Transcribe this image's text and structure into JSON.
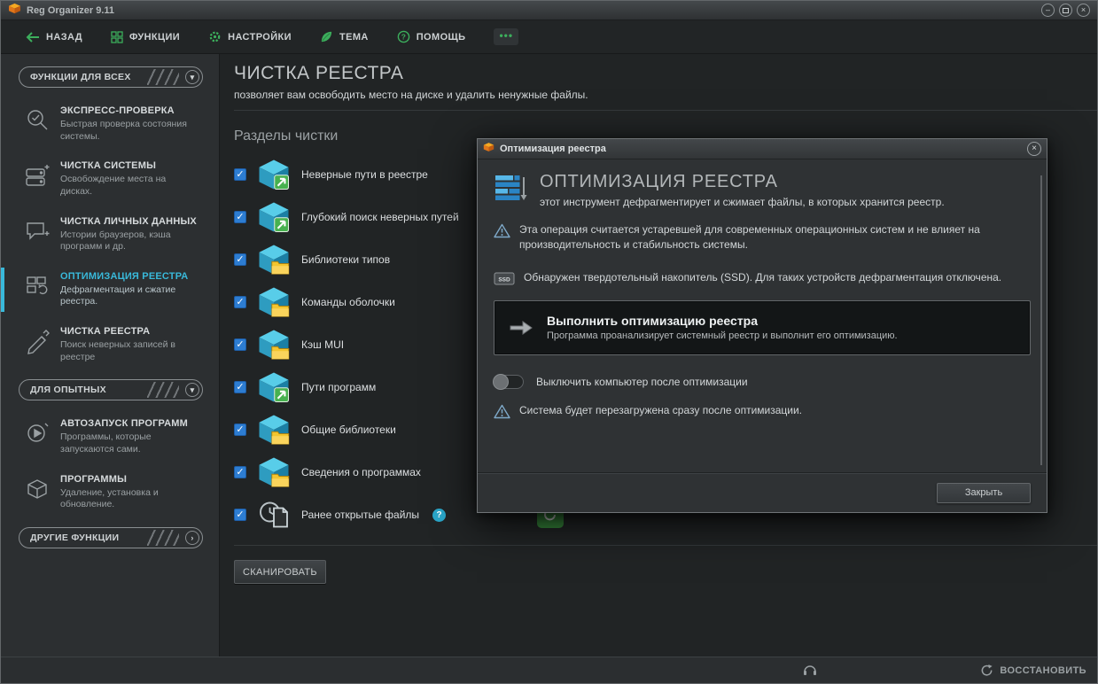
{
  "glyphs": {
    "close": "×",
    "minimize": "–",
    "chevron_down": "▾",
    "chevron_right": "›",
    "more": "•••",
    "check": "✓",
    "help": "?"
  },
  "window": {
    "title": "Reg Organizer 9.11"
  },
  "toolbar": {
    "back": "НАЗАД",
    "functions": "ФУНКЦИИ",
    "settings": "НАСТРОЙКИ",
    "theme": "ТЕМА",
    "help": "ПОМОЩЬ"
  },
  "sidebar": {
    "group1_header": "ФУНКЦИИ ДЛЯ ВСЕХ",
    "group2_header": "ДЛЯ ОПЫТНЫХ",
    "group3_header": "ДРУГИЕ ФУНКЦИИ",
    "items": [
      {
        "title": "ЭКСПРЕСС-ПРОВЕРКА",
        "desc": "Быстрая проверка состояния системы.",
        "icon": "magnifier-check",
        "active": false
      },
      {
        "title": "ЧИСТКА СИСТЕМЫ",
        "desc": "Освобождение места на дисках.",
        "icon": "disk-clean",
        "active": false
      },
      {
        "title": "ЧИСТКА ЛИЧНЫХ ДАННЫХ",
        "desc": "Истории браузеров, кэша программ и др.",
        "icon": "chat-bubble-clean",
        "active": false
      },
      {
        "title": "ОПТИМИЗАЦИЯ РЕЕСТРА",
        "desc": "Дефрагментация и сжатие реестра.",
        "icon": "defrag-blocks",
        "active": true
      },
      {
        "title": "ЧИСТКА РЕЕСТРА",
        "desc": "Поиск неверных записей в реестре",
        "icon": "eraser-registry",
        "active": false
      },
      {
        "title": "АВТОЗАПУСК ПРОГРАММ",
        "desc": "Программы, которые запускаются сами.",
        "icon": "autostart-play",
        "active": false
      },
      {
        "title": "ПРОГРАММЫ",
        "desc": "Удаление, установка и обновление.",
        "icon": "package-box",
        "active": false
      }
    ]
  },
  "main": {
    "title": "ЧИСТКА РЕЕСТРА",
    "subtitle": "позволяет вам освободить место на диске и удалить ненужные файлы.",
    "section_title": "Разделы чистки",
    "checklist": [
      {
        "label": "Неверные пути в реестре",
        "checked": true,
        "icon": "cube-arrow"
      },
      {
        "label": "Глубокий поиск неверных путей",
        "checked": true,
        "icon": "cube-arrow"
      },
      {
        "label": "Библиотеки типов",
        "checked": true,
        "icon": "cube-folder"
      },
      {
        "label": "Команды оболочки",
        "checked": true,
        "icon": "cube-folder"
      },
      {
        "label": "Кэш MUI",
        "checked": true,
        "icon": "cube-folder"
      },
      {
        "label": "Пути программ",
        "checked": true,
        "icon": "cube-arrow"
      },
      {
        "label": "Общие библиотеки",
        "checked": true,
        "icon": "cube-folder"
      },
      {
        "label": "Сведения о программах",
        "checked": true,
        "icon": "cube-folder"
      },
      {
        "label": "Ранее открытые файлы",
        "checked": true,
        "icon": "file-clock",
        "help": true
      }
    ],
    "scan_button": "СКАНИРОВАТЬ"
  },
  "dialog": {
    "title": "Оптимизация реестра",
    "heading": "ОПТИМИЗАЦИЯ РЕЕСТРА",
    "subheading": "этот инструмент дефрагментирует и сжимает файлы, в которых хранится реестр.",
    "warning1": "Эта операция считается устаревшей для современных операционных систем и не влияет на производительность и стабильность системы.",
    "ssd_note": "Обнаружен твердотельный накопитель (SSD). Для таких устройств дефрагментация отключена.",
    "action_title": "Выполнить оптимизацию реестра",
    "action_desc": "Программа проанализирует системный реестр и выполнит его оптимизацию.",
    "toggle_label": "Выключить компьютер после оптимизации",
    "toggle_state": "off",
    "warning2": "Система будет перезагружена сразу после оптимизации.",
    "close_button": "Закрыть"
  },
  "statusbar": {
    "restore": "ВОССТАНОВИТЬ"
  },
  "colors": {
    "accent_green": "#3cae5c",
    "accent_cyan": "#39b9da",
    "checkbox_blue": "#2d7dd2",
    "warning_blue": "#7fa9c9"
  }
}
